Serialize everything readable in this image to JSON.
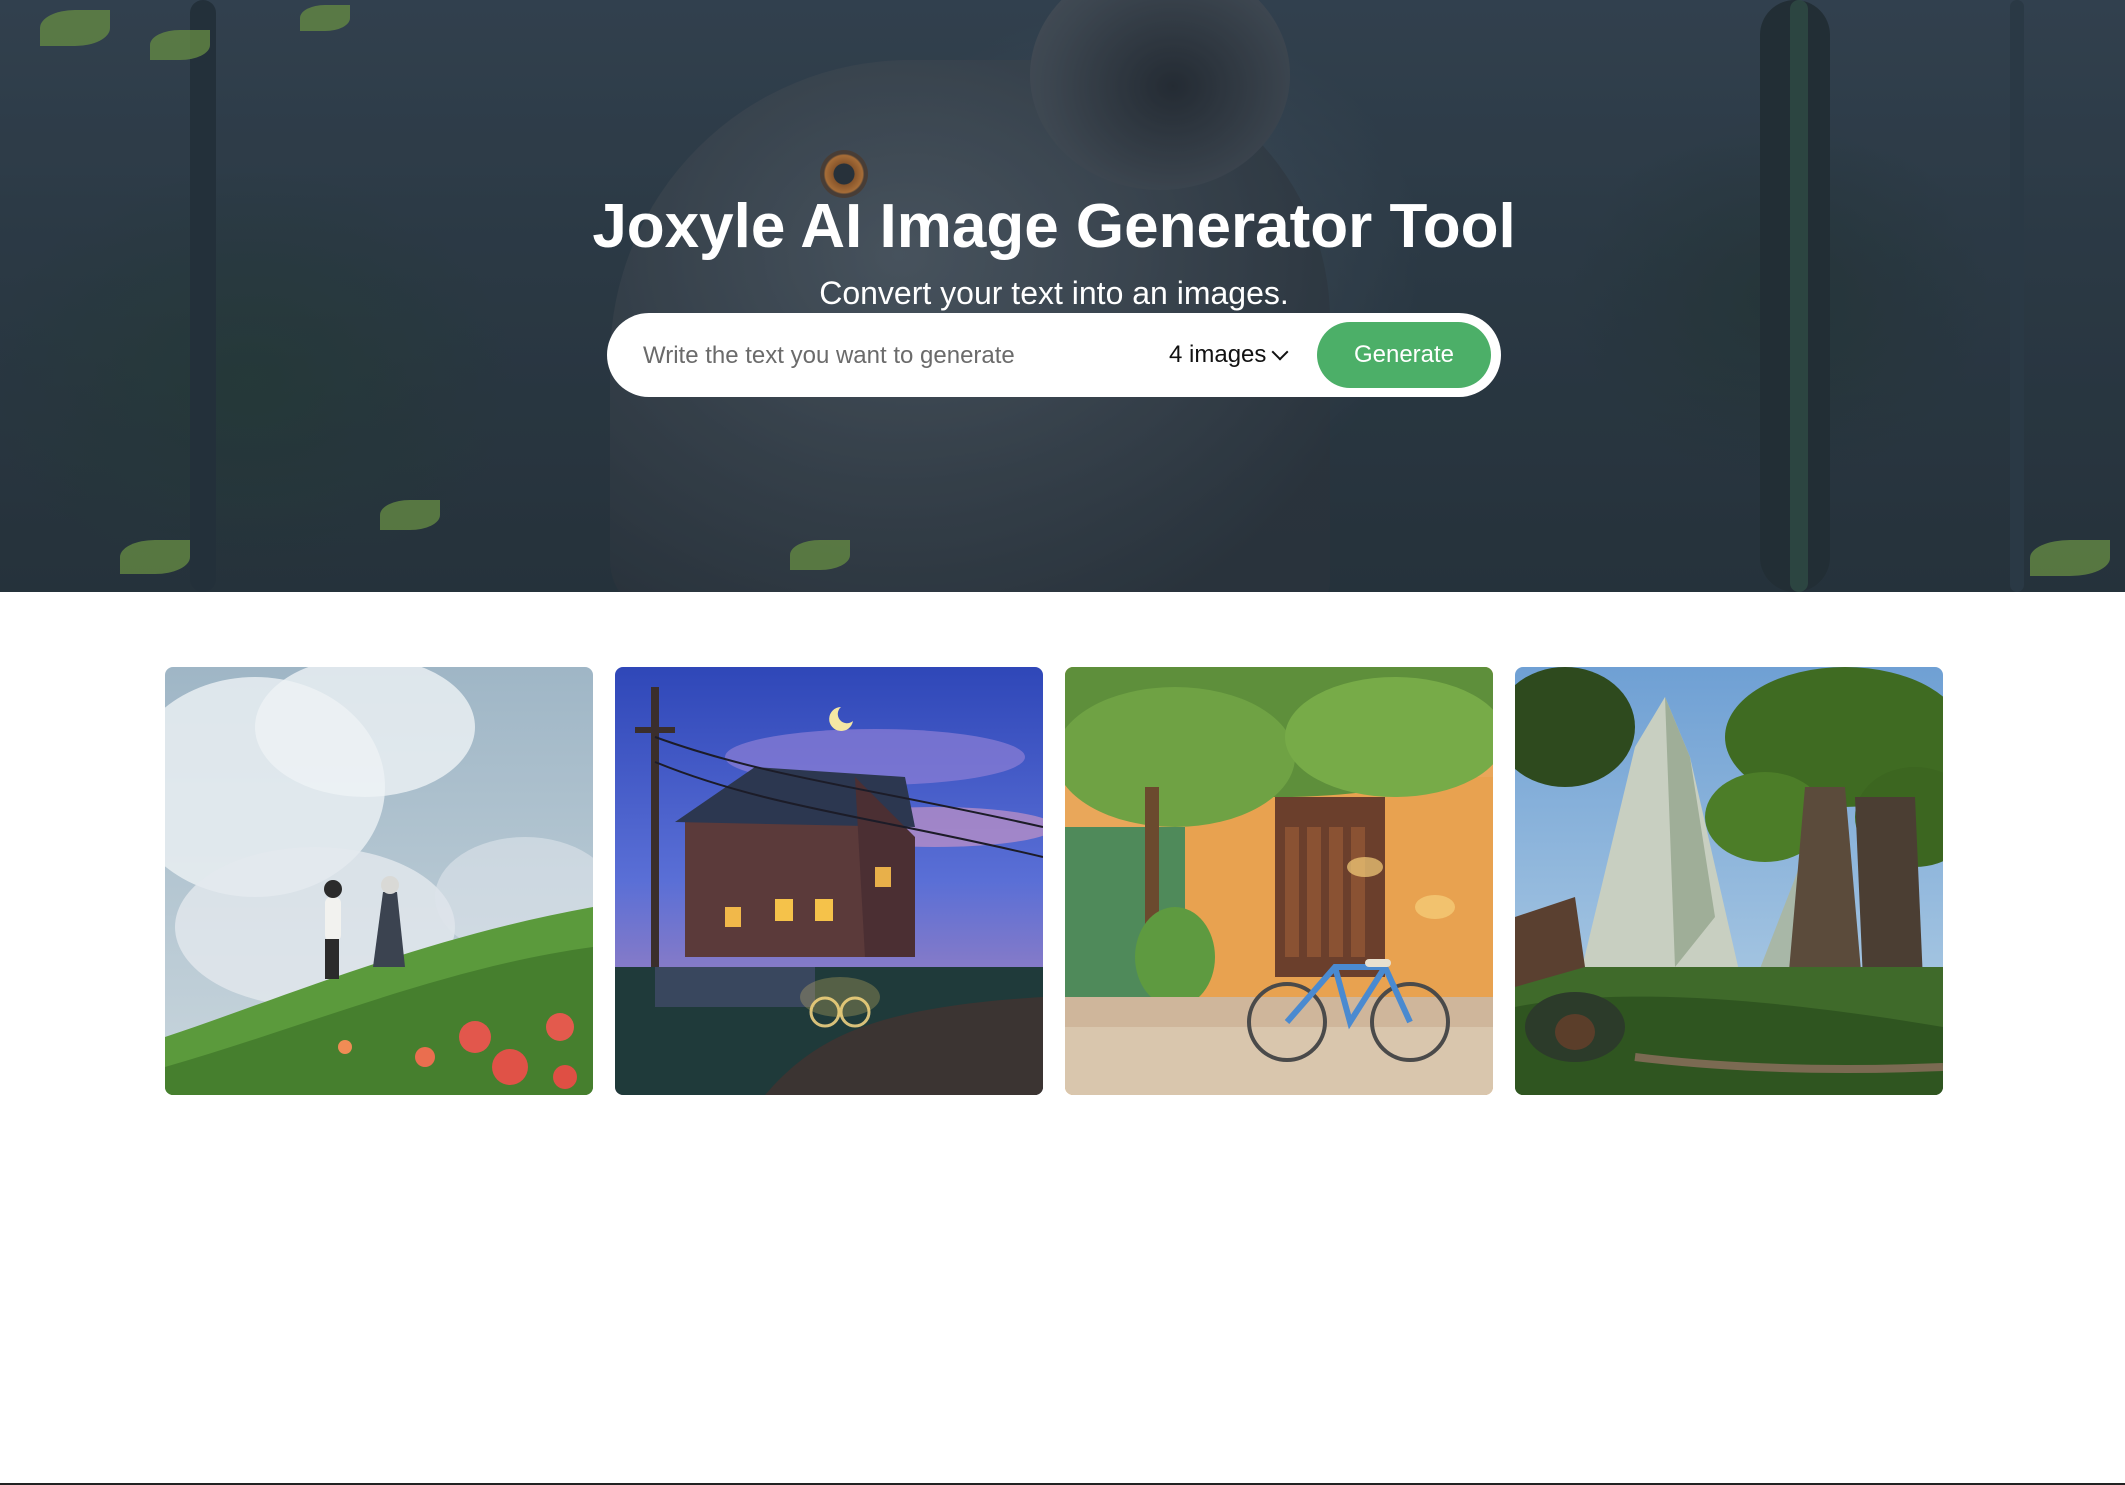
{
  "hero": {
    "title": "Joxyle AI Image Generator Tool",
    "subtitle": "Convert your text into an images.",
    "background_image": "astronaut-in-forest-illustration"
  },
  "search": {
    "placeholder": "Write the text you want to generate",
    "value": "",
    "count_selected": "4 images",
    "generate_label": "Generate"
  },
  "colors": {
    "accent": "#4caf68",
    "hero_overlay": "#34444f",
    "page_background": "#ffffff"
  },
  "gallery": [
    {
      "image": "girls-on-flower-hill-under-clouds"
    },
    {
      "image": "house-at-night-with-bicycle"
    },
    {
      "image": "bicycle-by-orange-wall-under-tree"
    },
    {
      "image": "fantasy-forest-with-mountain"
    }
  ]
}
